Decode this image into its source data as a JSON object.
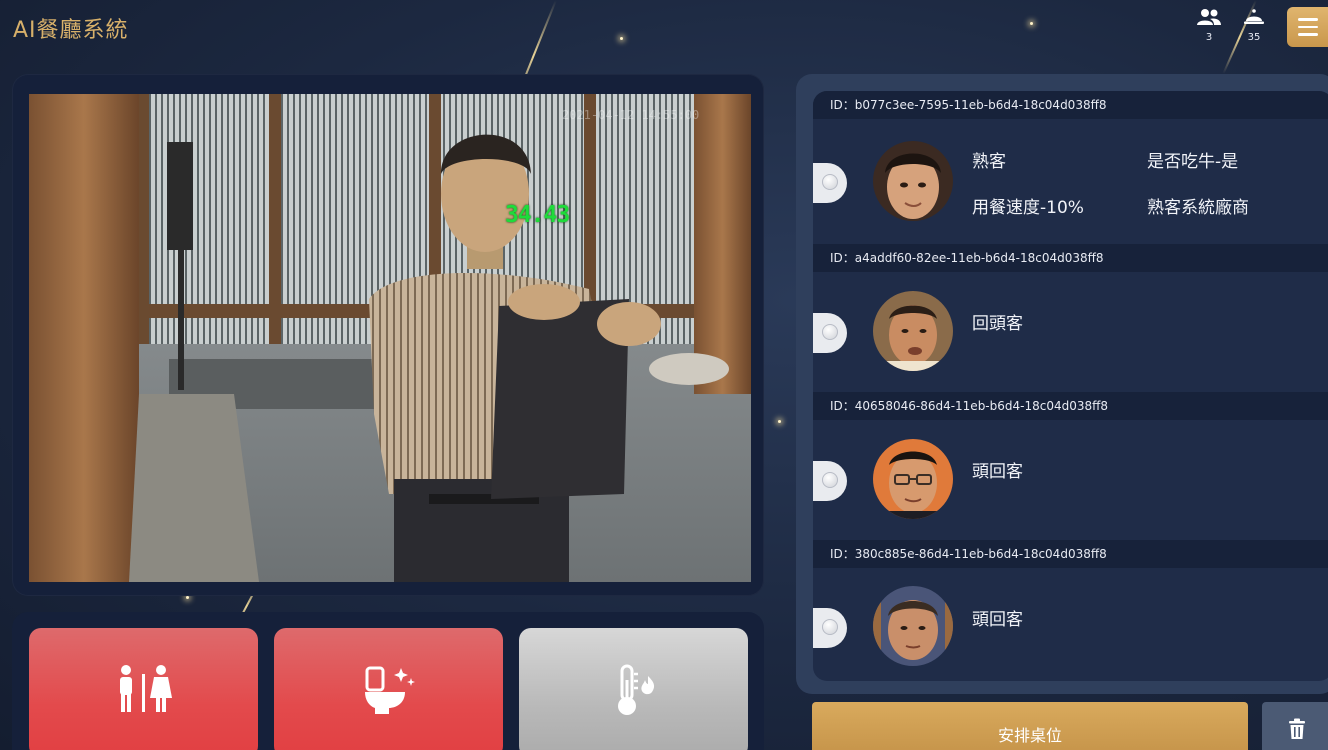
{
  "header": {
    "app_title": "AI餐廳系統",
    "guests_icon": "people-icon",
    "guests_count": "3",
    "served_icon": "cloche-icon",
    "served_count": "35",
    "menu_icon": "hamburger-menu-icon"
  },
  "camera": {
    "temperature": "34.43",
    "timestamp": "2021-04-12 14:55:00"
  },
  "quick_actions": [
    {
      "icon": "restroom-icon",
      "color": "#e34a4c"
    },
    {
      "icon": "toilet-cleaning-icon",
      "color": "#e34a4c"
    },
    {
      "icon": "thermometer-icon",
      "color": "#b9b9b9"
    }
  ],
  "customers": [
    {
      "id_label": "ID：b077c3ee-7595-11eb-b6d4-18c04d038ff8",
      "tags": [
        "熟客",
        "是否吃牛-是",
        "用餐速度-10%",
        "熟客系統廠商"
      ]
    },
    {
      "id_label": "ID：a4addf60-82ee-11eb-b6d4-18c04d038ff8",
      "tags": [
        "回頭客"
      ]
    },
    {
      "id_label": "ID：40658046-86d4-11eb-b6d4-18c04d038ff8",
      "tags": [
        "頭回客"
      ]
    },
    {
      "id_label": "ID：380c885e-86d4-11eb-b6d4-18c04d038ff8",
      "tags": [
        "頭回客"
      ]
    }
  ],
  "footer": {
    "arrange_label": "安排桌位",
    "trash_icon": "trash-icon"
  },
  "colors": {
    "accent_gold": "#c9974c",
    "alert_red": "#e34a4c",
    "panel": "#1f2c48",
    "temperature_green": "#1edc3a"
  }
}
